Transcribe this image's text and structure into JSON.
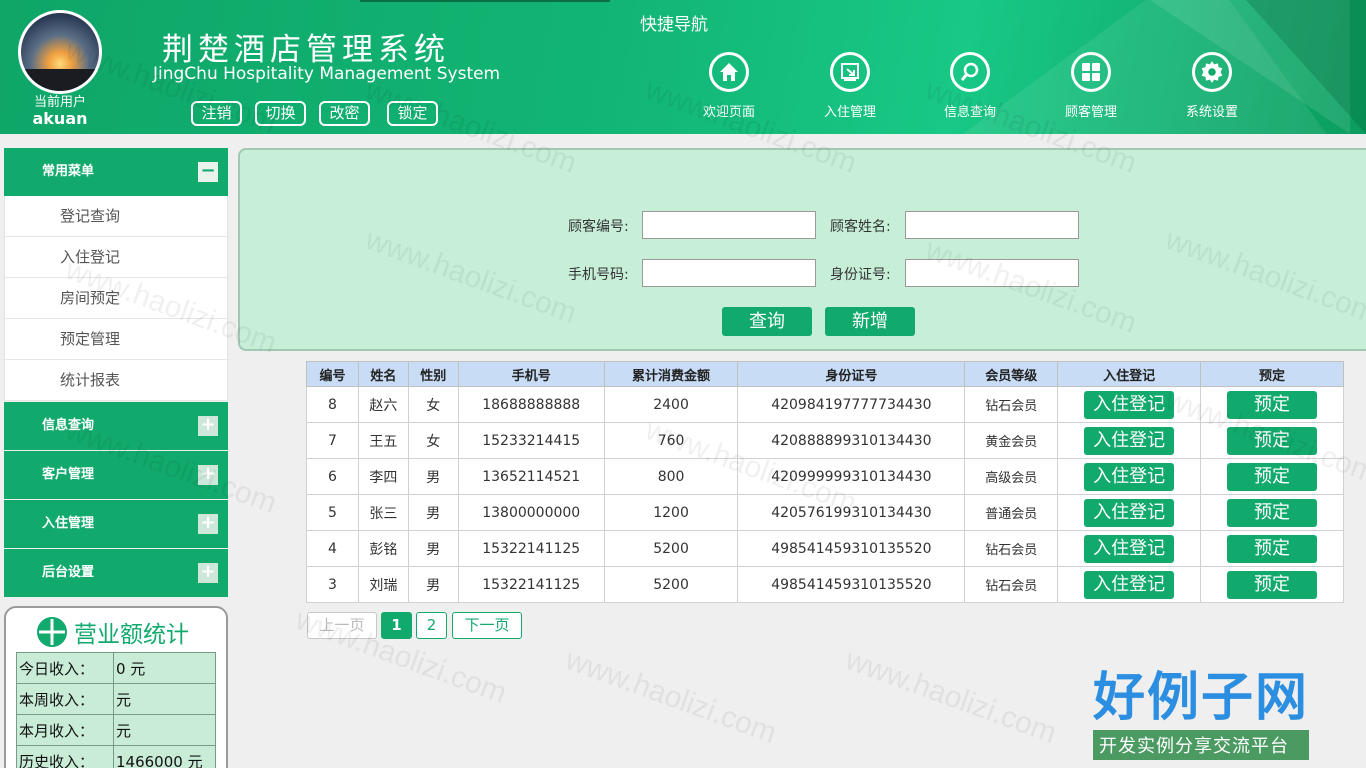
{
  "header": {
    "current_user_label": "当前用户",
    "username": "akuan",
    "title": "荆楚酒店管理系统",
    "subtitle": "JingChu Hospitality Management System",
    "buttons": [
      "注销",
      "切换",
      "改密",
      "锁定"
    ],
    "quick_nav_title": "快捷导航",
    "quick_nav": [
      {
        "label": "欢迎页面",
        "icon": "home-icon"
      },
      {
        "label": "入住管理",
        "icon": "checkin-icon"
      },
      {
        "label": "信息查询",
        "icon": "search-icon"
      },
      {
        "label": "顾客管理",
        "icon": "grid-icon"
      },
      {
        "label": "系统设置",
        "icon": "gear-icon"
      }
    ]
  },
  "sidebar": {
    "common_menu": {
      "title": "常用菜单",
      "toggle": "−",
      "items": [
        "登记查询",
        "入住登记",
        "房间预定",
        "预定管理",
        "统计报表"
      ]
    },
    "collapsed_menus": [
      {
        "title": "信息查询",
        "toggle": "+"
      },
      {
        "title": "客户管理",
        "toggle": "+"
      },
      {
        "title": "入住管理",
        "toggle": "+"
      },
      {
        "title": "后台设置",
        "toggle": "+"
      }
    ]
  },
  "revenue": {
    "title": "营业额统计",
    "rows": [
      {
        "label": "今日收入：",
        "value": "0 元"
      },
      {
        "label": "本周收入：",
        "value": "元"
      },
      {
        "label": "本月收入：",
        "value": "元"
      },
      {
        "label": "历史收入：",
        "value": "1466000 元"
      }
    ]
  },
  "search": {
    "customer_id_label": "顾客编号:",
    "customer_name_label": "顾客姓名:",
    "phone_label": "手机号码:",
    "id_card_label": "身份证号:",
    "customer_id_value": "",
    "customer_name_value": "",
    "phone_value": "",
    "id_card_value": "",
    "query_button": "查询",
    "add_button": "新增"
  },
  "table": {
    "columns": [
      "编号",
      "姓名",
      "性别",
      "手机号",
      "累计消费金额",
      "身份证号",
      "会员等级",
      "入住登记",
      "预定"
    ],
    "action_checkin": "入住登记",
    "action_reserve": "预定",
    "rows": [
      {
        "id": "8",
        "name": "赵六",
        "gender": "女",
        "phone": "18688888888",
        "spent": "2400",
        "id_card": "420984197777734430",
        "level": "钻石会员"
      },
      {
        "id": "7",
        "name": "王五",
        "gender": "女",
        "phone": "15233214415",
        "spent": "760",
        "id_card": "420888899310134430",
        "level": "黄金会员"
      },
      {
        "id": "6",
        "name": "李四",
        "gender": "男",
        "phone": "13652114521",
        "spent": "800",
        "id_card": "420999999310134430",
        "level": "高级会员"
      },
      {
        "id": "5",
        "name": "张三",
        "gender": "男",
        "phone": "13800000000",
        "spent": "1200",
        "id_card": "420576199310134430",
        "level": "普通会员"
      },
      {
        "id": "4",
        "name": "彭铭",
        "gender": "男",
        "phone": "15322141125",
        "spent": "5200",
        "id_card": "498541459310135520",
        "level": "钻石会员"
      },
      {
        "id": "3",
        "name": "刘瑞",
        "gender": "男",
        "phone": "15322141125",
        "spent": "5200",
        "id_card": "498541459310135520",
        "level": "钻石会员"
      }
    ]
  },
  "pagination": {
    "prev": "上一页",
    "pages": [
      "1",
      "2"
    ],
    "next": "下一页"
  },
  "watermark": {
    "text": "www.haolizi.com",
    "logo_big": "好例子网",
    "logo_small": "开发实例分享交流平台"
  },
  "colors": {
    "brand": "#12aa6c",
    "panel": "#c7efd8",
    "table_header": "#c8ddf5"
  }
}
